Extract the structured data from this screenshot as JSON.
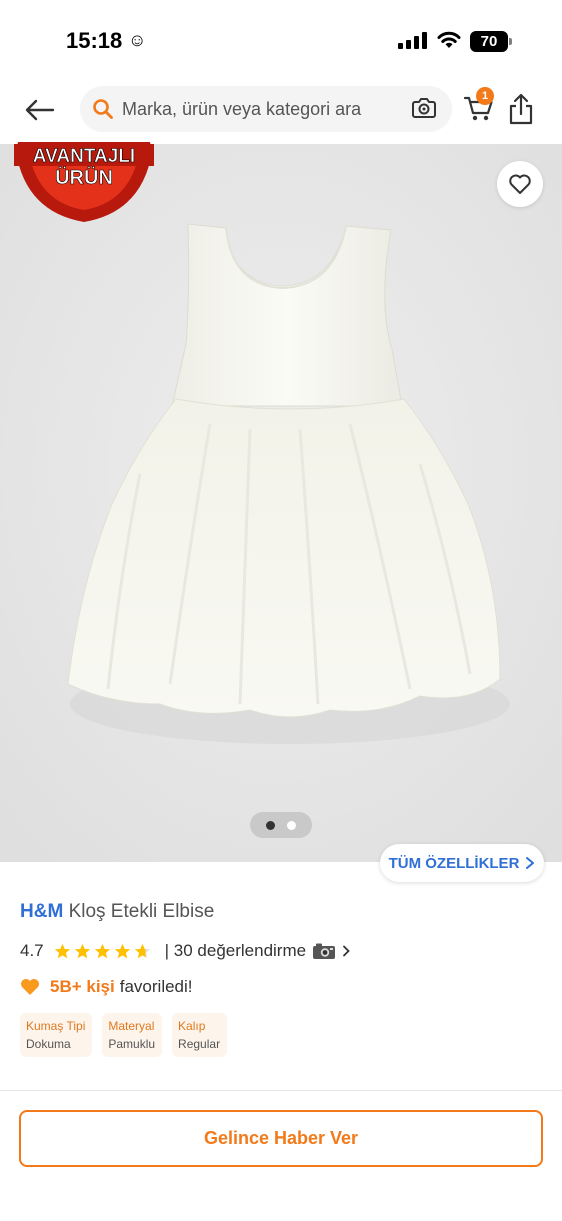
{
  "status_bar": {
    "time": "15:18",
    "emoji": "☺",
    "battery": "70"
  },
  "header": {
    "search_placeholder": "Marka, ürün veya kategori ara",
    "cart_count": "1"
  },
  "product_image": {
    "badge_line1": "AVANTAJLI",
    "badge_line2": "ÜRÜN",
    "page_count": 2,
    "current_page": 1,
    "all_features_label": "TÜM ÖZELLİKLER"
  },
  "product": {
    "brand": "H&M",
    "name": "Kloş Etekli Elbise",
    "rating": "4.7",
    "rating_fraction": 0.94,
    "review_text": "| 30 değerlendirme",
    "favorite_count": "5B+ kişi",
    "favorite_suffix": "favoriledi!",
    "attributes": [
      {
        "label": "Kumaş Tipi",
        "value": "Dokuma"
      },
      {
        "label": "Materyal",
        "value": "Pamuklu"
      },
      {
        "label": "Kalıp",
        "value": "Regular"
      }
    ]
  },
  "cta": {
    "label": "Gelince Haber Ver"
  },
  "colors": {
    "accent": "#f27a1a",
    "link_blue": "#2f6fd6",
    "star": "#ffc000"
  },
  "icons": [
    "back-arrow-icon",
    "search-icon",
    "camera-icon",
    "cart-icon",
    "share-icon",
    "heart-icon",
    "chevron-right-icon",
    "star-icon",
    "camera-emoji-icon",
    "heart-emoji-icon"
  ]
}
